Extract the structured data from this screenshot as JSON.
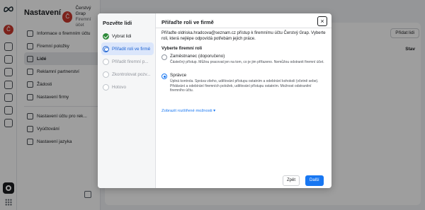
{
  "app": {
    "title": "Nastavení",
    "business_initial": "Č",
    "business_name": "Čerstvý Grap",
    "business_sub": "Firemní účet"
  },
  "sidebar": {
    "items": [
      {
        "label": "Informace o firemním účtu",
        "active": false
      },
      {
        "label": "Firemní položky",
        "active": false
      },
      {
        "label": "Lidé",
        "active": true
      },
      {
        "label": "Reklamní partnerství",
        "active": false
      },
      {
        "label": "Žádosti",
        "active": false
      },
      {
        "label": "Nastavení firmy",
        "active": false
      },
      {
        "label": "Nastavení účtu pro rek...",
        "active": false
      },
      {
        "label": "Vyúčtování",
        "active": false
      },
      {
        "label": "Nastavení jazyka",
        "active": false
      }
    ]
  },
  "main": {
    "add_button": "Přidat lidi",
    "column_status": "Stav"
  },
  "modal": {
    "left_title": "Pozvěte lidi",
    "steps": [
      {
        "label": "Vybrat lidi",
        "state": "done"
      },
      {
        "label": "Přiřadit roli ve firmě",
        "state": "current"
      },
      {
        "label": "Přiřadit firemní p...",
        "state": "todo"
      },
      {
        "label": "Zkontrolovat pozv...",
        "state": "todo"
      },
      {
        "label": "Hotovo",
        "state": "todo"
      }
    ],
    "title": "Přiřaďte roli ve firmě",
    "close_icon": "×",
    "description": "Přiřaďte oldriska.hradcova@seznam.cz přístup k firemnímu účtu Čerstvý Grap. Vyberte roli, která nejlépe odpovídá potřebám jejich práce.",
    "section_label": "Vyberte firemní roli",
    "options": [
      {
        "title": "Zaměstnanec (doporučeno)",
        "text": "Částečný přístup. Můžou pracovat jen na tom, co je jim přiřazeno. Nemůžou odstranit firemní účet.",
        "selected": false
      },
      {
        "title": "Správce",
        "text": "Úplná kontrola. Správa všeho, udělování přístupu ostatním a odebírání kohokoli (včetně sebe). Přidávání a odebírání firemních položek, udělování přístupu ostatním. Možnost odstranění firemního účtu.",
        "selected": true
      }
    ],
    "more_link": "Zobrazit rozšířené možnosti ▾",
    "back_button": "Zpět",
    "next_button": "Další"
  },
  "colors": {
    "accent": "#1877f2",
    "step_active_bg": "#dbe6fb",
    "done_green": "#2e8a3a"
  }
}
